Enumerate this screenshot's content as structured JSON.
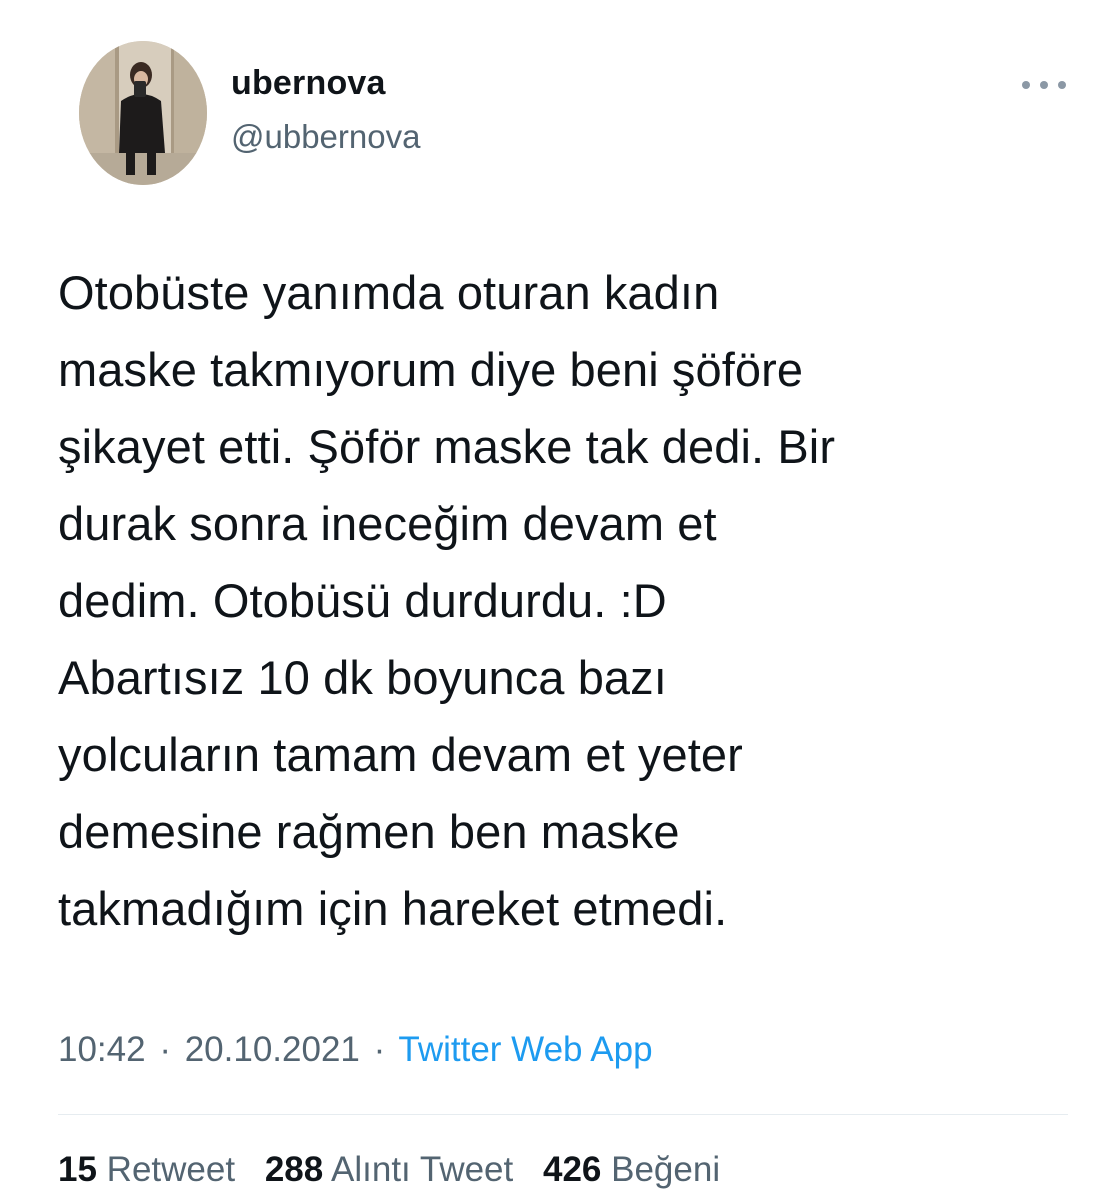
{
  "user": {
    "display_name": "ubernova",
    "handle": "@ubbernova",
    "avatar_icon": "profile-photo"
  },
  "more_icon": "more-dots-icon",
  "tweet": {
    "text": "Otobüste yanımda oturan kadın\nmaske takmıyorum diye beni şöföre\nşikayet etti. Şöför maske tak dedi. Bir\ndurak sonra ineceğim devam et\ndedim. Otobüsü durdurdu. :D\nAbartısız 10 dk boyunca bazı\nyolcuların tamam devam et yeter\ndemesine rağmen ben maske\ntakmadığım için hareket etmedi.",
    "time": "10:42",
    "date": "20.10.2021",
    "separator": "·",
    "source": "Twitter Web App"
  },
  "stats": {
    "retweets_count": "15",
    "retweets_label": "Retweet",
    "quotes_count": "288",
    "quotes_label": "Alıntı Tweet",
    "likes_count": "426",
    "likes_label": "Beğeni"
  },
  "colors": {
    "text": "#0f1419",
    "secondary": "#536471",
    "link": "#1d9bf0",
    "divider": "#e6ecf0"
  }
}
